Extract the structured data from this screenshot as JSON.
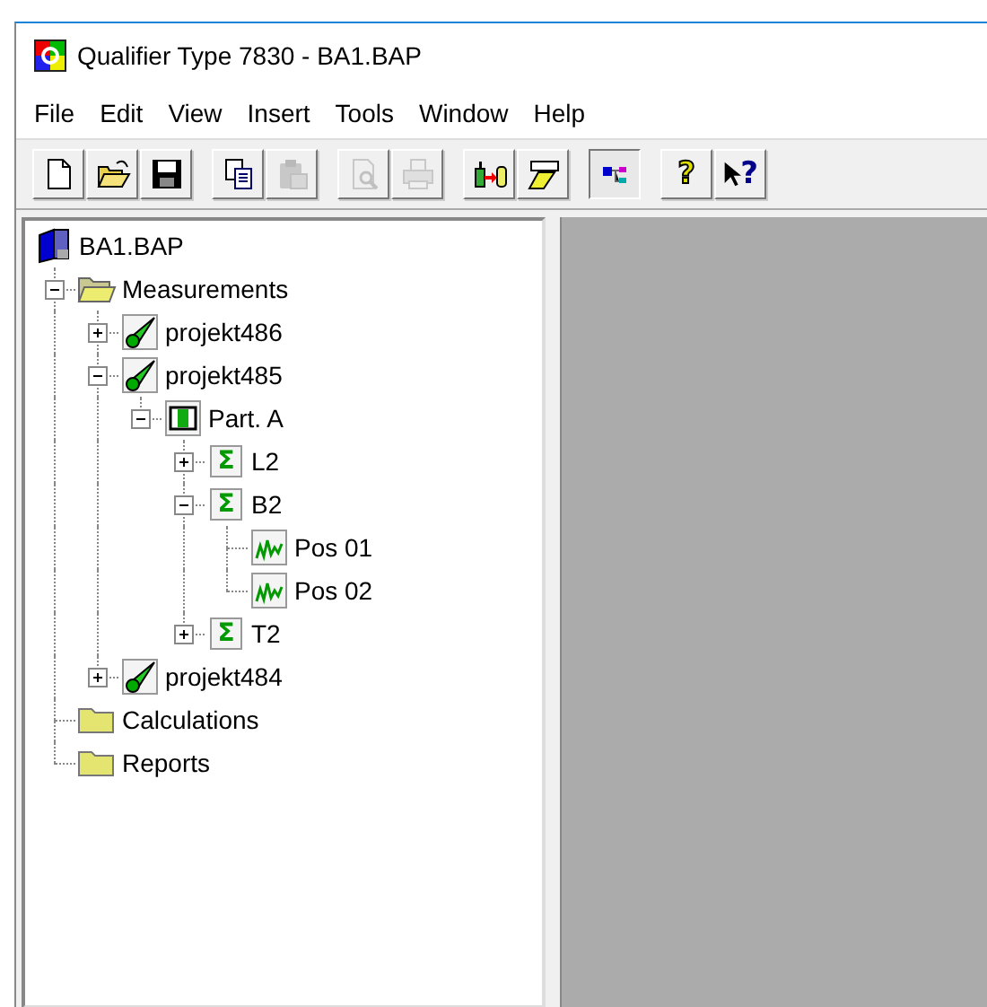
{
  "window": {
    "title": "Qualifier Type 7830 - BA1.BAP"
  },
  "menu": [
    "File",
    "Edit",
    "View",
    "Insert",
    "Tools",
    "Window",
    "Help"
  ],
  "toolbar": [
    [
      {
        "kind": "new",
        "disabled": false,
        "pressed": false
      },
      {
        "kind": "open",
        "disabled": false,
        "pressed": false
      },
      {
        "kind": "save",
        "disabled": false,
        "pressed": false
      }
    ],
    [
      {
        "kind": "copy",
        "disabled": false,
        "pressed": false
      },
      {
        "kind": "paste",
        "disabled": true,
        "pressed": false
      }
    ],
    [
      {
        "kind": "preview",
        "disabled": true,
        "pressed": false
      },
      {
        "kind": "print",
        "disabled": true,
        "pressed": false
      }
    ],
    [
      {
        "kind": "transfer",
        "disabled": false,
        "pressed": false
      },
      {
        "kind": "edit",
        "disabled": false,
        "pressed": false
      }
    ],
    [
      {
        "kind": "tree",
        "disabled": false,
        "pressed": true
      }
    ],
    [
      {
        "kind": "help",
        "glyph": "?",
        "disabled": false,
        "pressed": false
      },
      {
        "kind": "context-help",
        "glyph": "?",
        "disabled": false,
        "pressed": false
      }
    ]
  ],
  "tree": [
    {
      "label": "BA1.BAP",
      "kind": "book",
      "children": [
        {
          "label": "Measurements",
          "kind": "folder-open",
          "expanded": true,
          "children": [
            {
              "label": "projekt486",
              "kind": "probe",
              "expanded": false
            },
            {
              "label": "projekt485",
              "kind": "probe",
              "expanded": true,
              "children": [
                {
                  "label": "Part. A",
                  "kind": "part",
                  "expanded": true,
                  "children": [
                    {
                      "label": "L2",
                      "kind": "sigma",
                      "glyph": "Σ",
                      "expanded": false
                    },
                    {
                      "label": "B2",
                      "kind": "sigma",
                      "glyph": "Σ",
                      "expanded": true,
                      "children": [
                        {
                          "label": "Pos 01",
                          "kind": "graph"
                        },
                        {
                          "label": "Pos 02",
                          "kind": "graph"
                        }
                      ]
                    },
                    {
                      "label": "T2",
                      "kind": "sigma",
                      "glyph": "Σ",
                      "expanded": false
                    }
                  ]
                }
              ]
            },
            {
              "label": "projekt484",
              "kind": "probe",
              "expanded": false
            }
          ]
        },
        {
          "label": "Calculations",
          "kind": "folder"
        },
        {
          "label": "Reports",
          "kind": "folder"
        }
      ]
    }
  ]
}
